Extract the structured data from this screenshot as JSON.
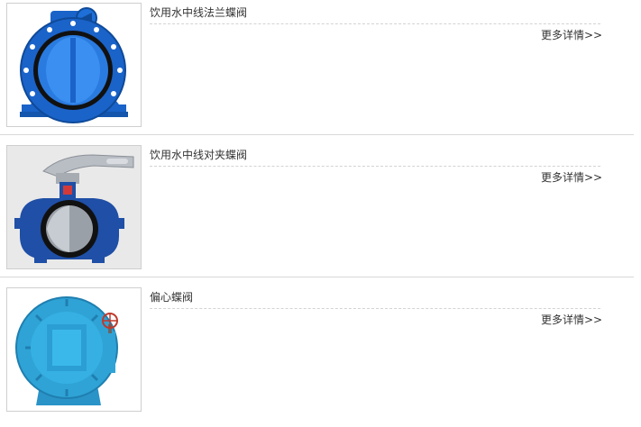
{
  "products": [
    {
      "title": "饮用水中线法兰蝶阀",
      "more_label": "更多详情>>",
      "image_icon": "flanged-butterfly-valve-image",
      "accent": "#1a63c9"
    },
    {
      "title": "饮用水中线对夹蝶阀",
      "more_label": "更多详情>>",
      "image_icon": "wafer-butterfly-valve-image",
      "accent": "#1f4fa6"
    },
    {
      "title": "偏心蝶阀",
      "more_label": "更多详情>>",
      "image_icon": "eccentric-butterfly-valve-image",
      "accent": "#2fa3d6"
    }
  ]
}
